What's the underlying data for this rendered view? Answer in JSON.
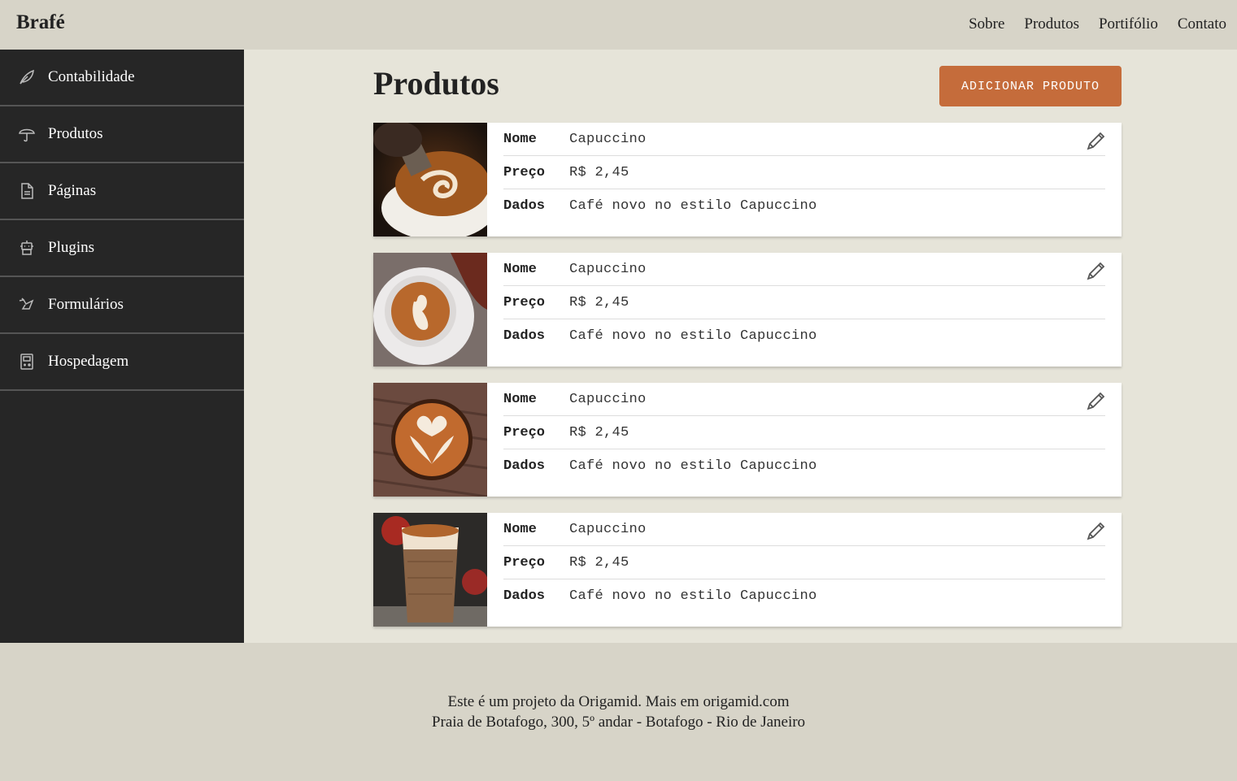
{
  "header": {
    "logo": "Brafé",
    "nav": [
      "Sobre",
      "Produtos",
      "Portifólio",
      "Contato"
    ]
  },
  "sidebar": {
    "items": [
      {
        "label": "Contabilidade",
        "icon": "leaf-icon"
      },
      {
        "label": "Produtos",
        "icon": "umbrella-icon"
      },
      {
        "label": "Páginas",
        "icon": "document-icon"
      },
      {
        "label": "Plugins",
        "icon": "robot-icon"
      },
      {
        "label": "Formulários",
        "icon": "bird-icon"
      },
      {
        "label": "Hospedagem",
        "icon": "gameboy-icon"
      }
    ]
  },
  "main": {
    "title": "Produtos",
    "add_button": "ADICIONAR PRODUTO",
    "field_labels": {
      "name": "Nome",
      "price": "Preço",
      "data": "Dados"
    },
    "products": [
      {
        "name": "Capuccino",
        "price": "R$ 2,45",
        "data": "Café novo no estilo Capuccino",
        "image": "latte-art-pour-photo"
      },
      {
        "name": "Capuccino",
        "price": "R$ 2,45",
        "data": "Café novo no estilo Capuccino",
        "image": "latte-swan-cup-photo"
      },
      {
        "name": "Capuccino",
        "price": "R$ 2,45",
        "data": "Café novo no estilo Capuccino",
        "image": "latte-heart-wood-photo"
      },
      {
        "name": "Capuccino",
        "price": "R$ 2,45",
        "data": "Café novo no estilo Capuccino",
        "image": "glass-latte-cinnamon-photo"
      }
    ]
  },
  "footer": {
    "line1": "Este é um projeto da Origamid. Mais em origamid.com",
    "line2": "Praia de Botafogo, 300, 5º andar - Botafogo - Rio de Janeiro"
  },
  "colors": {
    "accent": "#c56c3b",
    "sidebar": "#262626",
    "main_bg": "#e6e4d9",
    "chrome_bg": "#d7d4c8"
  }
}
